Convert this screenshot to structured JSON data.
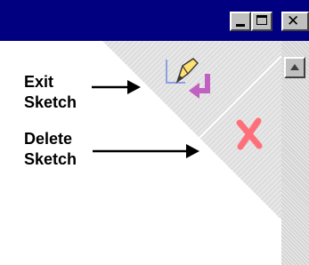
{
  "window": {
    "controls": {
      "minimize_icon": "minimize-icon",
      "maximize_icon": "maximize-icon",
      "close_icon": "close-icon",
      "close_glyph": "✕"
    },
    "titlebar_color": "#000080"
  },
  "labels": {
    "exit_sketch": "Exit\nSketch",
    "delete_sketch": "Delete\nSketch"
  },
  "corner_tools": {
    "exit_icon": "pencil-return-icon",
    "delete_icon": "red-x-icon",
    "delete_color": "#ff6f7a",
    "exit_arrow_color": "#c060c0",
    "pencil_color": "#ffe070"
  },
  "scrollbar": {
    "up_arrow_icon": "scroll-up-arrow-icon"
  }
}
